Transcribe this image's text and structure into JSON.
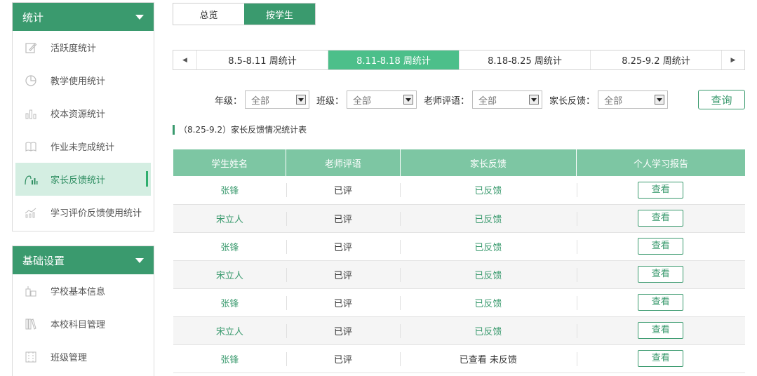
{
  "sidebar": {
    "stats": {
      "title": "统计",
      "items": [
        {
          "label": "活跃度统计",
          "icon": "edit-icon"
        },
        {
          "label": "教学使用统计",
          "icon": "pie-chart-icon"
        },
        {
          "label": "校本资源统计",
          "icon": "bar-chart-icon"
        },
        {
          "label": "作业未完成统计",
          "icon": "book-icon"
        },
        {
          "label": "家长反馈统计",
          "icon": "feedback-chart-icon"
        },
        {
          "label": "学习评价反馈使用统计",
          "icon": "trend-chart-icon"
        }
      ],
      "active_index": 4
    },
    "settings": {
      "title": "基础设置",
      "items": [
        {
          "label": "学校基本信息",
          "icon": "school-icon"
        },
        {
          "label": "本校科目管理",
          "icon": "books-icon"
        },
        {
          "label": "班级管理",
          "icon": "class-icon"
        }
      ]
    }
  },
  "view_toggle": {
    "overview": "总览",
    "by_student": "按学生",
    "active": "by_student"
  },
  "weeks": {
    "items": [
      "8.5-8.11 周统计",
      "8.11-8.18 周统计",
      "8.18-8.25 周统计",
      "8.25-9.2 周统计"
    ],
    "active_index": 1
  },
  "filters": {
    "grade_label": "年级：",
    "grade_value": "全部",
    "class_label": "班级：",
    "class_value": "全部",
    "comment_label": "老师评语：",
    "comment_value": "全部",
    "feedback_label": "家长反馈：",
    "feedback_value": "全部",
    "query_label": "查询"
  },
  "table_title": "（8.25-9.2）家长反馈情况统计表",
  "table": {
    "headers": [
      "学生姓名",
      "老师评语",
      "家长反馈",
      "个人学习报告"
    ],
    "rows": [
      {
        "name": "张锋",
        "comment": "已评",
        "feedback": "已反馈",
        "report": "查看"
      },
      {
        "name": "宋立人",
        "comment": "已评",
        "feedback": "已反馈",
        "report": "查看"
      },
      {
        "name": "张锋",
        "comment": "已评",
        "feedback": "已反馈",
        "report": "查看"
      },
      {
        "name": "宋立人",
        "comment": "已评",
        "feedback": "已反馈",
        "report": "查看"
      },
      {
        "name": "张锋",
        "comment": "已评",
        "feedback": "已反馈",
        "report": "查看"
      },
      {
        "name": "宋立人",
        "comment": "已评",
        "feedback": "已反馈",
        "report": "查看"
      },
      {
        "name": "张锋",
        "comment": "已评",
        "feedback": "已查看 未反馈",
        "report": "查看"
      }
    ]
  },
  "colors": {
    "accent": "#3a9a6e",
    "active_tab": "#4cbf8a",
    "table_header": "#7dc6a3"
  }
}
